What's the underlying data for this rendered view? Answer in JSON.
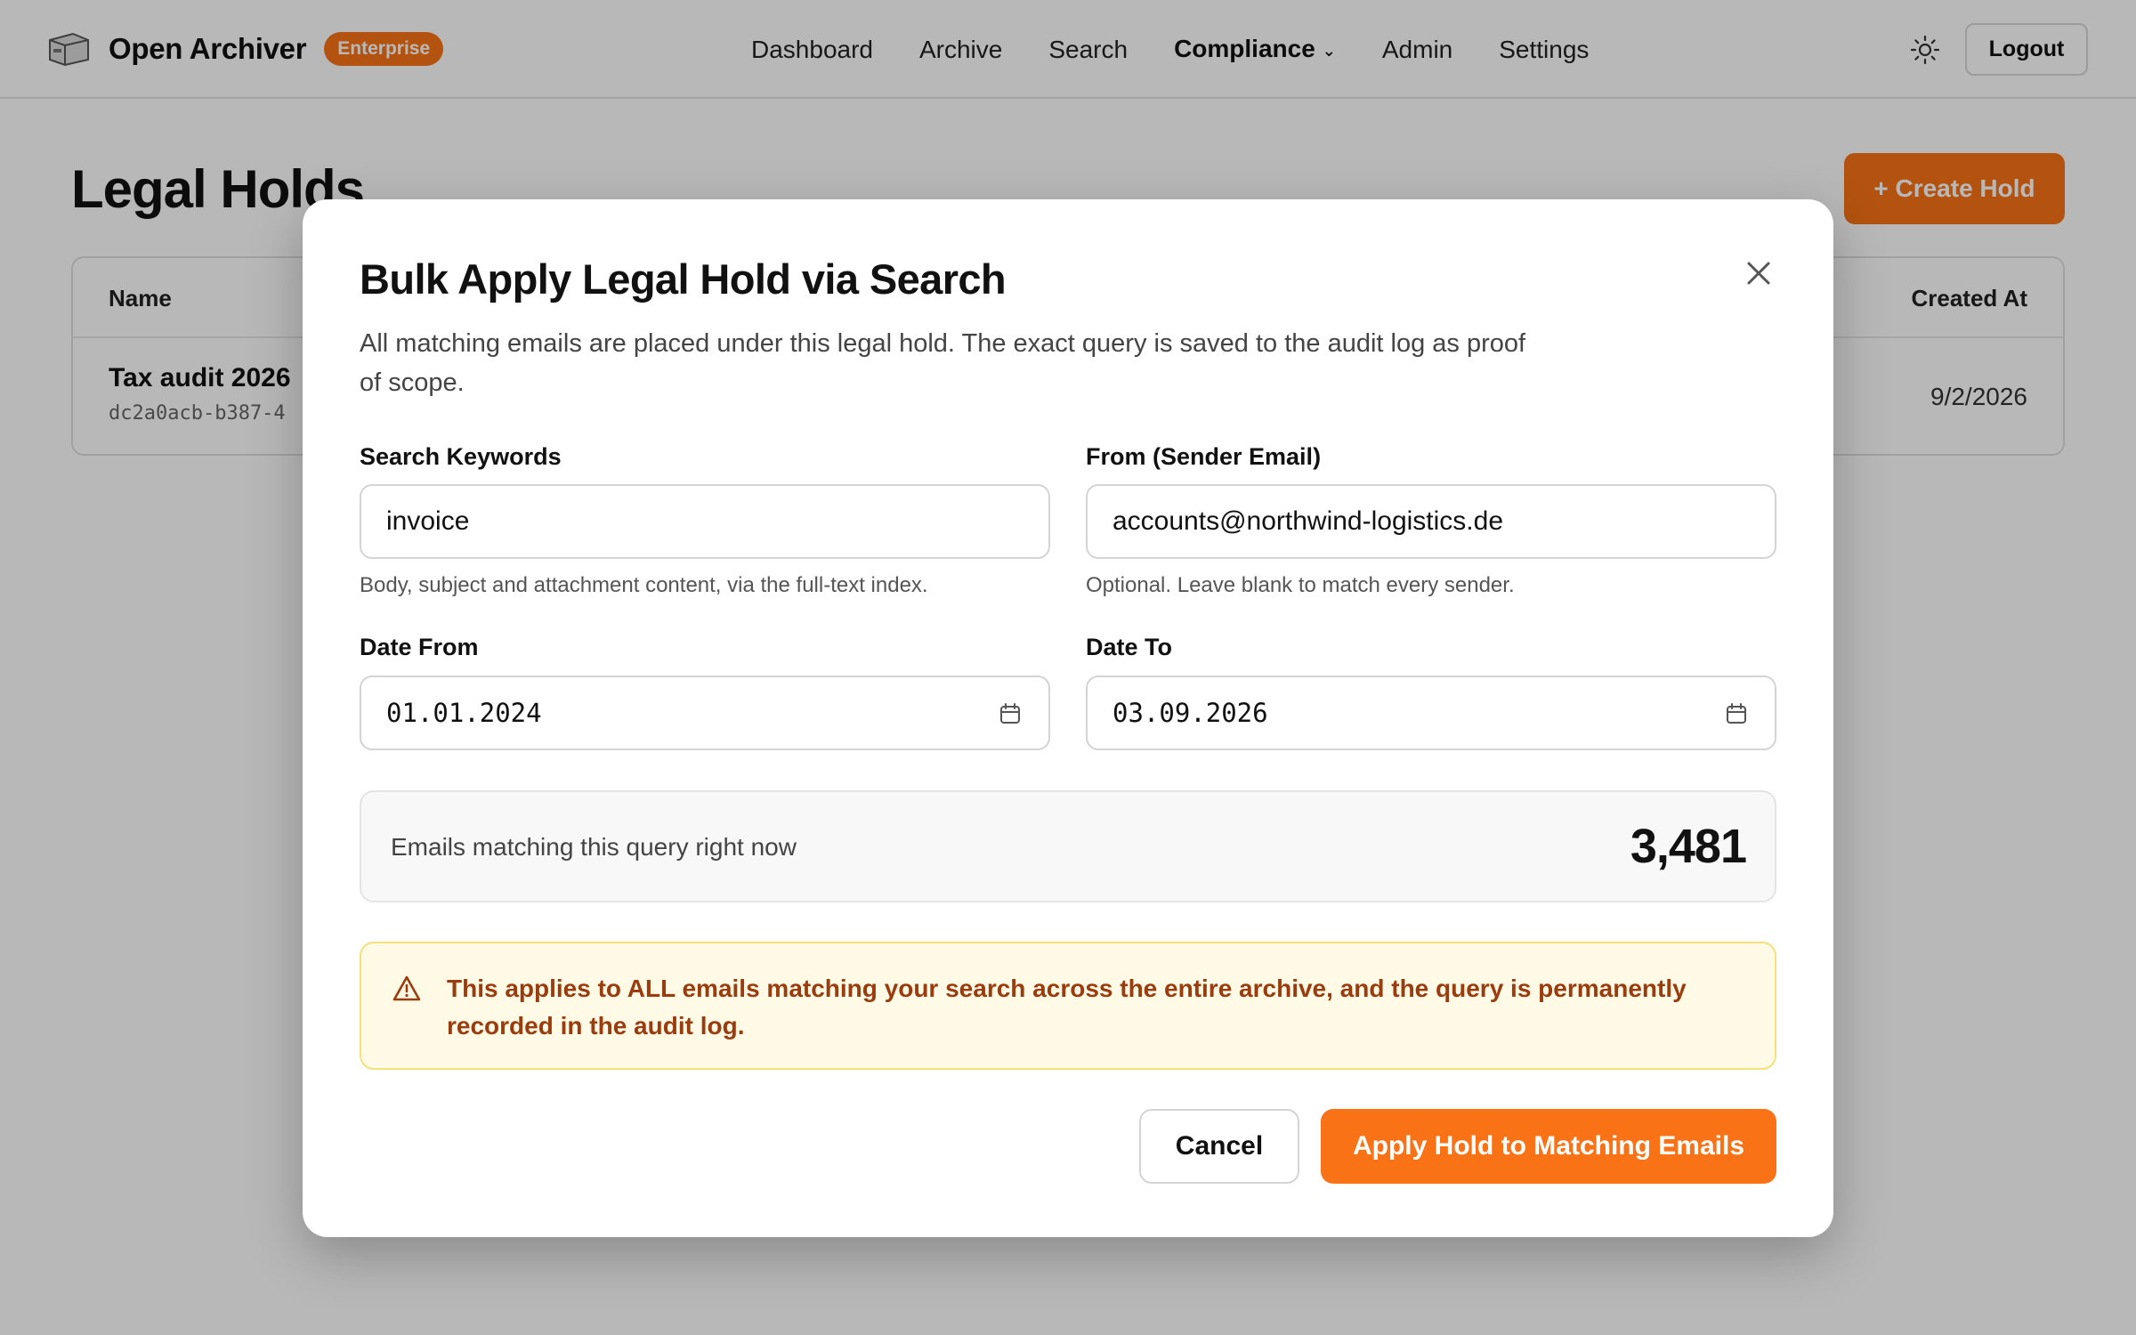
{
  "header": {
    "app_name": "Open Archiver",
    "badge": "Enterprise",
    "nav": [
      {
        "label": "Dashboard",
        "active": false
      },
      {
        "label": "Archive",
        "active": false
      },
      {
        "label": "Search",
        "active": false
      },
      {
        "label": "Compliance",
        "active": true,
        "has_dropdown": true
      },
      {
        "label": "Admin",
        "active": false
      },
      {
        "label": "Settings",
        "active": false
      }
    ],
    "theme_icon": "sun-icon",
    "logout_label": "Logout"
  },
  "page": {
    "title": "Legal Holds",
    "create_button": "+ Create Hold",
    "table": {
      "columns": {
        "name": "Name",
        "created_at": "Created At"
      },
      "rows": [
        {
          "name": "Tax audit 2026",
          "id": "dc2a0acb-b387-4",
          "created_at": "9/2/2026"
        }
      ]
    }
  },
  "modal": {
    "title": "Bulk Apply Legal Hold via Search",
    "description": "All matching emails are placed under this legal hold. The exact query is saved to the audit log as proof of scope.",
    "fields": {
      "keywords": {
        "label": "Search Keywords",
        "value": "invoice",
        "hint": "Body, subject and attachment content, via the full-text index."
      },
      "from": {
        "label": "From (Sender Email)",
        "value": "accounts@northwind-logistics.de",
        "hint": "Optional. Leave blank to match every sender."
      },
      "date_from": {
        "label": "Date From",
        "value": "01.01.2024"
      },
      "date_to": {
        "label": "Date To",
        "value": "03.09.2026"
      }
    },
    "match_count": {
      "label": "Emails matching this query right now",
      "value": "3,481"
    },
    "warning": "This applies to ALL emails matching your search across the entire archive, and the query is permanently recorded in the audit log.",
    "cancel_label": "Cancel",
    "apply_label": "Apply Hold to Matching Emails"
  },
  "colors": {
    "accent": "#f97316",
    "warning_bg": "#fefae6",
    "warning_border": "#f6e07a",
    "warning_text": "#9a3c0e"
  }
}
